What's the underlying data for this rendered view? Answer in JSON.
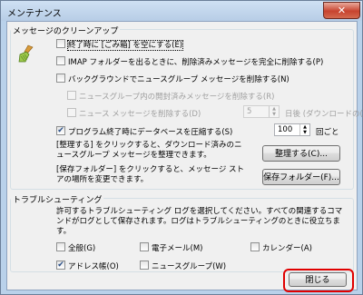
{
  "window": {
    "title": "メンテナンス",
    "close_glyph": "✕"
  },
  "cleanup": {
    "legend": "メッセージのクリーンアップ",
    "empty_deleted": "終了時に [ごみ箱] を空にする(E)",
    "imap_purge": "IMAP フォルダーを出るときに、削除済みメッセージを完全に削除する(P)",
    "bg_purge": "バックグラウンドでニュースグループ メッセージを削除する(N)",
    "delete_read": "ニュースグループ内の開封済みメッセージを削除する(R)",
    "delete_news": "ニュース メッセージを削除する(D)",
    "days_value": "5",
    "days_suffix": "日後 (ダウンロードの(X)",
    "compact": "プログラム終了時にデータベースを圧縮する(S)",
    "compact_value": "100",
    "compact_suffix": "回ごと",
    "cleanup_text": "[整理する] をクリックすると、ダウンロード済みのニュースグループ メッセージを整理できます。",
    "cleanup_button": "整理する(C)...",
    "store_text": "[保存フォルダー] をクリックすると、メッセージ ストアの場所を変更できます。",
    "store_button": "保存フォルダー(F)..."
  },
  "trouble": {
    "legend": "トラブルシューティング",
    "description": "許可するトラブルシューティング ログを選択してください。すべての関連するコマンドがログとして保存されます。ログはトラブルシューティングのときに役立ちます。",
    "general": "全般(G)",
    "mail": "電子メール(M)",
    "calendar": "カレンダー(A)",
    "contacts": "アドレス帳(O)",
    "news": "ニュースグループ(W)"
  },
  "footer": {
    "close_button": "閉じる"
  },
  "checks": {
    "empty_deleted": false,
    "imap_purge": false,
    "bg_purge": false,
    "delete_read": false,
    "delete_news": false,
    "compact": true,
    "general": false,
    "mail": false,
    "calendar": false,
    "contacts": true,
    "news": false
  },
  "icons": {
    "broom": "broom-icon",
    "check": "✔"
  },
  "colors": {
    "highlight": "#e00000",
    "title_bar": "#b9d1ea"
  }
}
